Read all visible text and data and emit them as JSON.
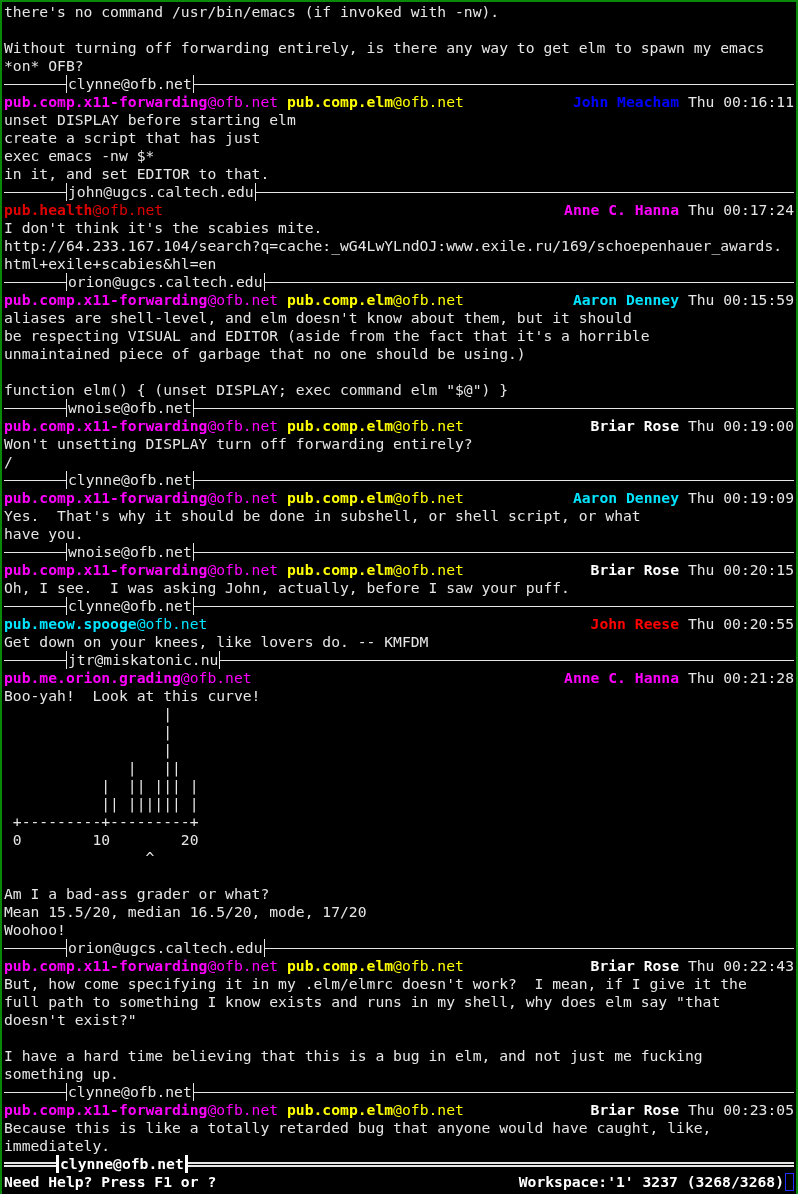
{
  "previous_message_tail": [
    [
      "there's no command /usr/bin/emacs (if invoked with -nw)."
    ],
    [
      "Without turning off forwarding entirely, is there any way to get elm to spawn my emacs",
      "*on* OFB?"
    ]
  ],
  "messages": [
    {
      "divider": "clynne@ofb.net",
      "groups": [
        {
          "address": "**pub.comp.x11-forwarding**@ofb.net",
          "color": "#ff00ff"
        },
        {
          "address": "**pub.comp.elm**@ofb.net",
          "color": "#ffff00"
        }
      ],
      "author": {
        "name": "John Meacham",
        "color": "#0000ff"
      },
      "time": "Thu 00:16:11",
      "body": [
        [
          "unset DISPLAY before starting elm",
          "create a script that has just",
          "exec emacs -nw $*",
          "in it, and set EDITOR to that."
        ]
      ]
    },
    {
      "divider": "john@ugcs.caltech.edu",
      "groups": [
        {
          "address": "**pub.health**@ofb.net",
          "color": "#e00000"
        }
      ],
      "author": {
        "name": "Anne C. Hanna",
        "color": "#ff00ff"
      },
      "time": "Thu 00:17:24",
      "body": [
        [
          "I don't think it's the scabies mite.",
          "http://64.233.167.104/search?q=cache:_wG4LwYLndOJ:www.exile.ru/169/schoepenhauer_awards.",
          "html+exile+scabies&hl=en"
        ]
      ]
    },
    {
      "divider": "orion@ugcs.caltech.edu",
      "groups": [
        {
          "address": "**pub.comp.x11-forwarding**@ofb.net",
          "color": "#ff00ff"
        },
        {
          "address": "**pub.comp.elm**@ofb.net",
          "color": "#ffff00"
        }
      ],
      "author": {
        "name": "Aaron Denney",
        "color": "#00e5ff"
      },
      "time": "Thu 00:15:59",
      "body": [
        [
          "aliases are shell-level, and elm doesn't know about them, but it should",
          "be respecting VISUAL and EDITOR (aside from the fact that it's a horrible",
          "unmaintained piece of garbage that no one should be using.)"
        ],
        [
          "function elm() { (unset DISPLAY; exec command elm \"$@\") }"
        ]
      ]
    },
    {
      "divider": "wnoise@ofb.net",
      "groups": [
        {
          "address": "**pub.comp.x11-forwarding**@ofb.net",
          "color": "#ff00ff"
        },
        {
          "address": "**pub.comp.elm**@ofb.net",
          "color": "#ffff00"
        }
      ],
      "author": {
        "name": "Briar Rose",
        "color": "#ffffff"
      },
      "time": "Thu 00:19:00",
      "body": [
        [
          "Won't unsetting DISPLAY turn off forwarding entirely?",
          "/"
        ]
      ]
    },
    {
      "divider": "clynne@ofb.net",
      "groups": [
        {
          "address": "**pub.comp.x11-forwarding**@ofb.net",
          "color": "#ff00ff"
        },
        {
          "address": "**pub.comp.elm**@ofb.net",
          "color": "#ffff00"
        }
      ],
      "author": {
        "name": "Aaron Denney",
        "color": "#00e5ff"
      },
      "time": "Thu 00:19:09",
      "body": [
        [
          "Yes.  That's why it should be done in subshell, or shell script, or what",
          "have you."
        ]
      ]
    },
    {
      "divider": "wnoise@ofb.net",
      "groups": [
        {
          "address": "**pub.comp.x11-forwarding**@ofb.net",
          "color": "#ff00ff"
        },
        {
          "address": "**pub.comp.elm**@ofb.net",
          "color": "#ffff00"
        }
      ],
      "author": {
        "name": "Briar Rose",
        "color": "#ffffff"
      },
      "time": "Thu 00:20:15",
      "body": [
        [
          "Oh, I see.  I was asking John, actually, before I saw your puff."
        ]
      ]
    },
    {
      "divider": "clynne@ofb.net",
      "groups": [
        {
          "address": "**pub.meow.spooge**@ofb.net",
          "color": "#00e5ff"
        }
      ],
      "author": {
        "name": "John Reese",
        "color": "#ff0000"
      },
      "time": "Thu 00:20:55",
      "body": [
        [
          "Get down on your knees, like lovers do. -- KMFDM"
        ]
      ]
    },
    {
      "divider": "jtr@miskatonic.nu",
      "groups": [
        {
          "address": "**pub.me.orion.grading**@ofb.net",
          "color": "#ff00ff"
        }
      ],
      "author": {
        "name": "Anne C. Hanna",
        "color": "#ff00ff"
      },
      "time": "Thu 00:21:28",
      "body": [
        [
          "Boo-yah!  Look at this curve!",
          "                  |",
          "                  |",
          "                  |",
          "              |   ||",
          "           |  || ||| |",
          "           || |||||| |",
          " +---------+---------+",
          " 0        10        20",
          "                ^"
        ],
        [
          "Am I a bad-ass grader or what?",
          "Mean 15.5/20, median 16.5/20, mode, 17/20",
          "Woohoo!"
        ]
      ]
    },
    {
      "divider": "orion@ugcs.caltech.edu",
      "groups": [
        {
          "address": "**pub.comp.x11-forwarding**@ofb.net",
          "color": "#ff00ff"
        },
        {
          "address": "**pub.comp.elm**@ofb.net",
          "color": "#ffff00"
        }
      ],
      "author": {
        "name": "Briar Rose",
        "color": "#ffffff"
      },
      "time": "Thu 00:22:43",
      "body": [
        [
          "But, how come specifying it in my .elm/elmrc doesn't work?  I mean, if I give it the",
          "full path to something I know exists and runs in my shell, why does elm say \"that",
          "doesn't exist?\""
        ],
        [
          "I have a hard time believing that this is a bug in elm, and not just me fucking",
          "something up."
        ]
      ]
    },
    {
      "divider": "clynne@ofb.net",
      "groups": [
        {
          "address": "**pub.comp.x11-forwarding**@ofb.net",
          "color": "#ff00ff"
        },
        {
          "address": "**pub.comp.elm**@ofb.net",
          "color": "#ffff00"
        }
      ],
      "author": {
        "name": "Briar Rose",
        "color": "#ffffff"
      },
      "time": "Thu 00:23:05",
      "body": [
        [
          "Because this is like a totally retarded bug that anyone would have caught, like,",
          "immediately."
        ]
      ]
    }
  ],
  "current_divider": "clynne@ofb.net",
  "status_bar": {
    "help": "Need Help? Press F1 or ?",
    "position": "Workspace:'1' 3237 (3268/3268)"
  }
}
